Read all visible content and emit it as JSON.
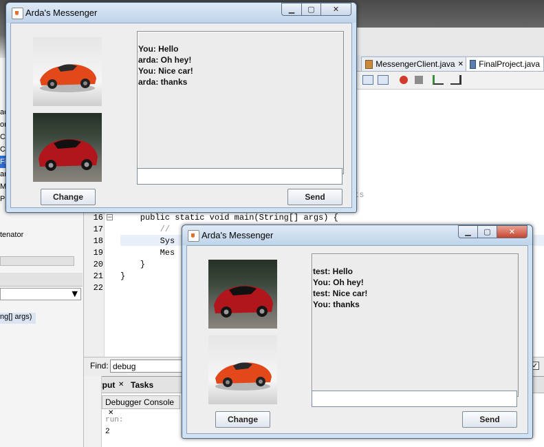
{
  "ide": {
    "tabs": [
      "MessengerClient.java",
      "FinalProject.java"
    ],
    "code_lines": [
      {
        "num": "16",
        "text": "    public static void main(String[] args) {"
      },
      {
        "num": "17",
        "text": "        //"
      },
      {
        "num": "18",
        "text": "        Sys"
      },
      {
        "num": "19",
        "text": "        Mes"
      },
      {
        "num": "20",
        "text": "    }"
      },
      {
        "num": "21",
        "text": "}"
      },
      {
        "num": "22",
        "text": ""
      }
    ],
    "left_items": [
      "ac",
      "ore",
      "Ch",
      "Co",
      "Fin",
      "am",
      "Me",
      "Pro"
    ],
    "left_tenator": "tenator",
    "left_args": "ng[] args)",
    "find_label": "Find:",
    "find_value": "debug",
    "output_tab": "Output",
    "tasks_tab": "Tasks",
    "console_tab": "Debugger Console",
    "console_lines": [
      "run:",
      "2"
    ]
  },
  "window1": {
    "title": "Arda's Messenger",
    "messages": [
      "You: Hello",
      "arda: Oh hey!",
      "You: Nice car!",
      "arda: thanks"
    ],
    "input_value": "",
    "change_label": "Change",
    "send_label": "Send"
  },
  "window2": {
    "title": "Arda's Messenger",
    "messages": [
      "test: Hello",
      "You: Oh hey!",
      "test: Nice car!",
      "You: thanks"
    ],
    "input_value": "",
    "change_label": "Change",
    "send_label": "Send"
  },
  "colors": {
    "titlebar": "#cfe1f3",
    "close": "#c7452f",
    "keyword": "#0000e6"
  }
}
